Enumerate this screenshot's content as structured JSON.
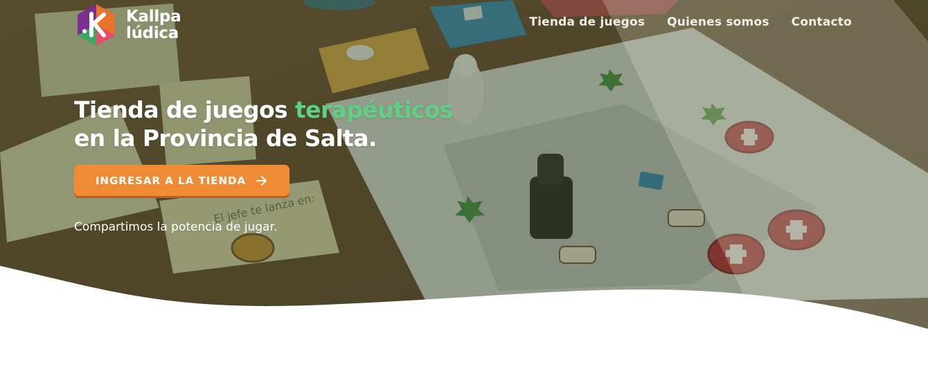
{
  "brand": {
    "name_line1": "Kallpa",
    "name_line2": "lúdica",
    "logo_colors": [
      "#7a2f8f",
      "#e8732b",
      "#3aa863",
      "#e84b6a"
    ]
  },
  "nav": {
    "items": [
      {
        "label": "Tienda de juegos"
      },
      {
        "label": "Quienes somos"
      },
      {
        "label": "Contacto"
      }
    ]
  },
  "hero": {
    "headline_line1_start": "Tienda de juegos ",
    "headline_accent": "terapéuticos",
    "headline_line2": "en la Provincia de Salta.",
    "accent_color": "#5fcf86",
    "cta_label": "INGRESAR A LA TIENDA",
    "cta_color": "#ef8b35",
    "cta_icon": "arrow-right-icon",
    "tagline": "Compartimos la potencia de jugar."
  },
  "background": {
    "card_text": "El jefe te lanza en:"
  }
}
